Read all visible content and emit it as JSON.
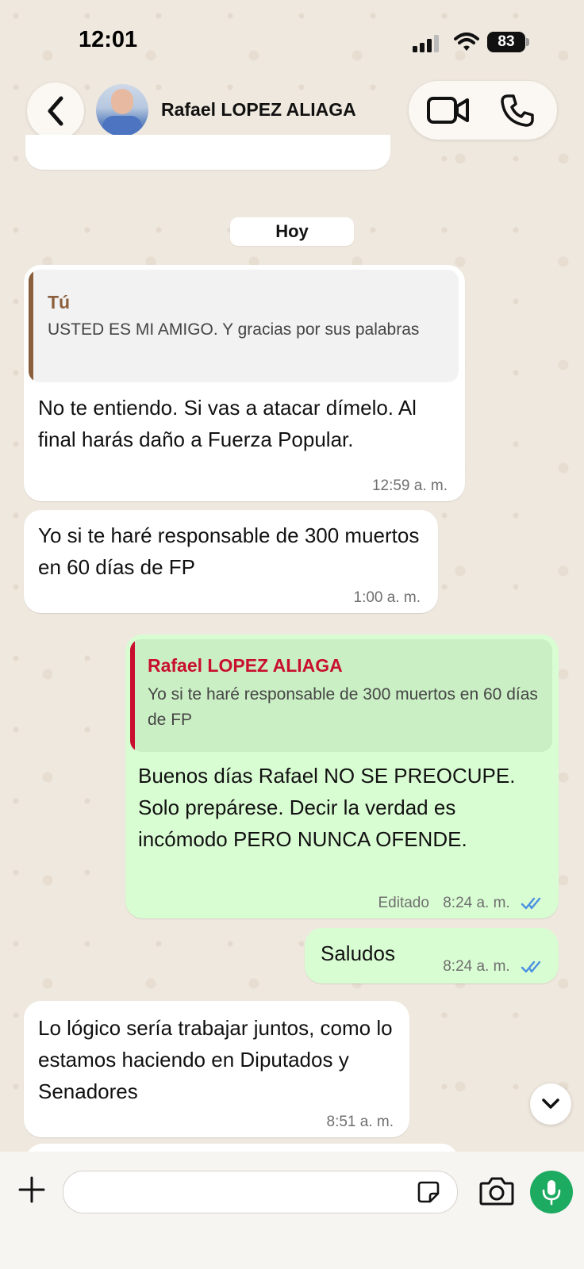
{
  "status_bar": {
    "time": "12:01",
    "battery": "83"
  },
  "header": {
    "contact_name": "Rafael LOPEZ ALIAGA"
  },
  "date_separator": "Hoy",
  "messages": [
    {
      "direction": "incoming",
      "quote": {
        "author": "Tú",
        "text": "USTED ES MI AMIGO. Y gracias por sus palabras"
      },
      "text": "No te entiendo. Si vas a atacar dímelo. Al final harás daño a Fuerza Popular.",
      "time": "12:59 a. m."
    },
    {
      "direction": "incoming",
      "text": "Yo si te haré responsable de 300 muertos en 60 días de FP",
      "time": "1:00 a. m."
    },
    {
      "direction": "outgoing",
      "quote": {
        "author": "Rafael LOPEZ ALIAGA",
        "text": "Yo si te haré responsable de 300 muertos en 60 días de FP"
      },
      "text": "Buenos días Rafael  NO SE PREOCUPE. Solo prepárese. Decir la verdad es incómodo PERO NUNCA OFENDE.",
      "edited_label": "Editado",
      "time": "8:24 a. m.",
      "read": true
    },
    {
      "direction": "outgoing",
      "text": "Saludos",
      "time": "8:24 a. m.",
      "read": true
    },
    {
      "direction": "incoming",
      "text": "Lo lógico sería trabajar juntos, como lo estamos haciendo en Diputados y Senadores",
      "time": "8:51 a. m."
    }
  ],
  "composer": {
    "placeholder": ""
  },
  "icons": {
    "back": "chevron-left-icon",
    "video": "video-camera-icon",
    "phone": "phone-icon",
    "scroll": "chevron-down-icon",
    "plus": "plus-icon",
    "sticker": "sticker-icon",
    "camera": "camera-icon",
    "mic": "microphone-icon"
  },
  "colors": {
    "incoming_bubble": "#ffffff",
    "outgoing_bubble": "#d9fdd3",
    "quote_self_bar": "#8b5e3c",
    "quote_contact_bar": "#c8102e",
    "read_ticks": "#4a90e2",
    "mic_button": "#1daa61"
  }
}
